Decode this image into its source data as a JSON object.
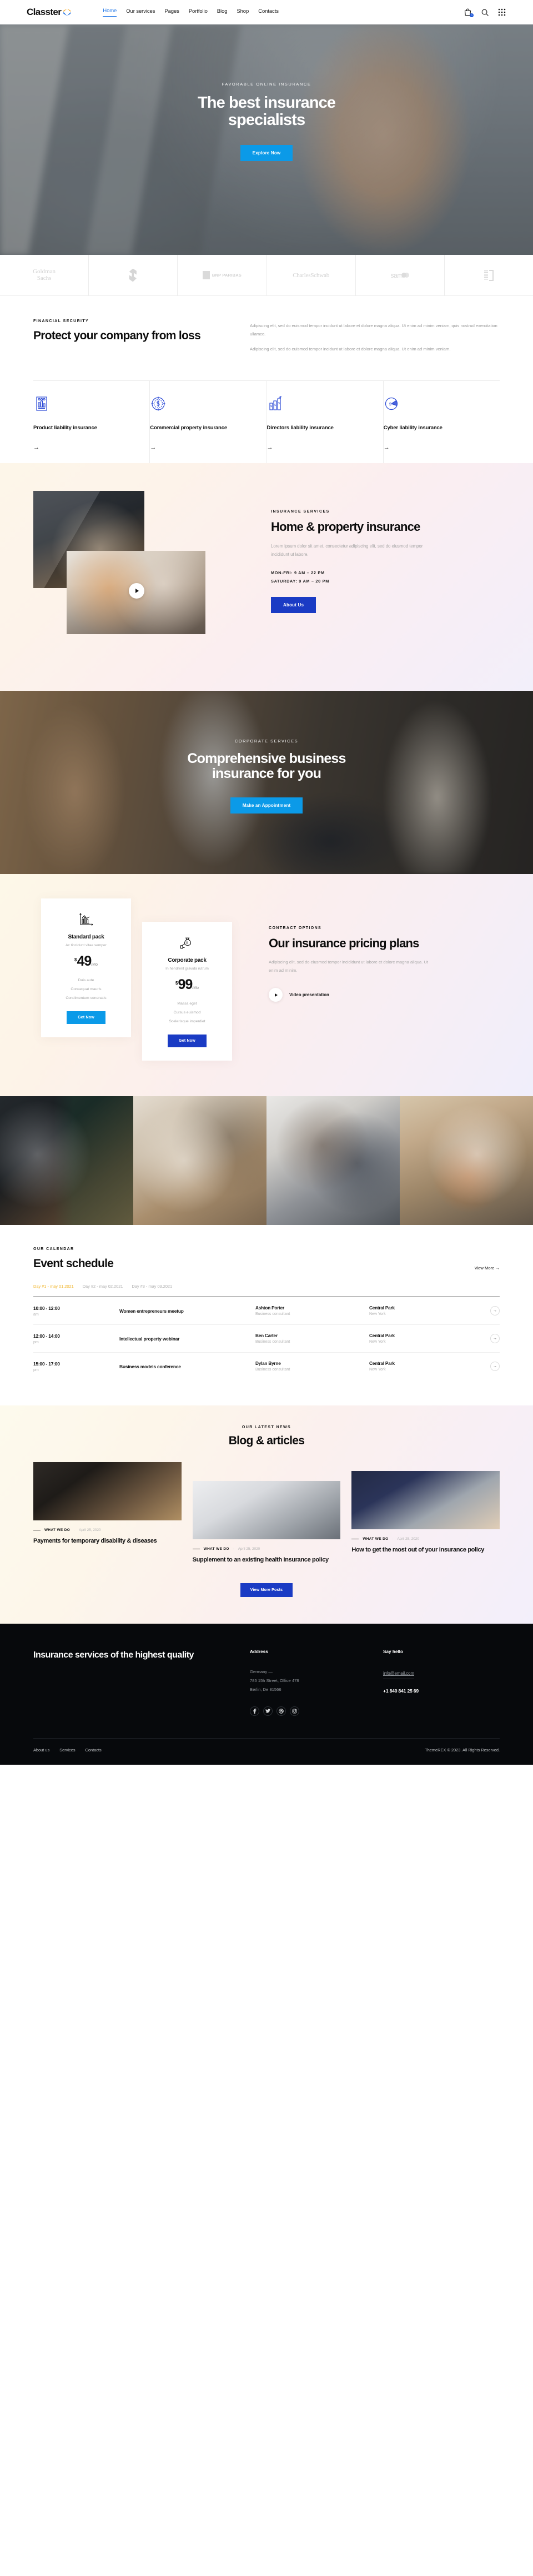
{
  "brand": {
    "name": "Classter",
    "logo_icon": "chevron-double-logo"
  },
  "nav": {
    "items": [
      {
        "label": "Home",
        "active": true
      },
      {
        "label": "Our services",
        "active": false
      },
      {
        "label": "Pages",
        "active": false
      },
      {
        "label": "Portfolio",
        "active": false
      },
      {
        "label": "Blog",
        "active": false
      },
      {
        "label": "Shop",
        "active": false
      },
      {
        "label": "Contacts",
        "active": false
      }
    ],
    "icons": {
      "cart": "shopping-bag-icon",
      "cart_count": "0",
      "search": "search-icon",
      "menu": "grid-menu-icon"
    }
  },
  "hero": {
    "eyebrow": "FAVORABLE ONLINE INSURANCE",
    "title_line1": "The best insurance",
    "title_line2": "specialists",
    "cta": "Explore Now",
    "cta_color": "#0b9ae8"
  },
  "partners": [
    {
      "name": "Goldman Sachs",
      "line1": "Goldman",
      "line2": "Sachs",
      "type": "text"
    },
    {
      "name": "swirl-logo",
      "type": "swirl"
    },
    {
      "name": "BNP PARIBAS",
      "label": "BNP PARIBAS",
      "type": "bnp"
    },
    {
      "name": "Charles Schwab",
      "label": "CharlesSchwab",
      "type": "serif"
    },
    {
      "name": "sam",
      "label": "sam",
      "type": "sam"
    },
    {
      "name": "bracket-logo",
      "type": "bracket"
    }
  ],
  "protect": {
    "eyebrow": "FINANCIAL SECURITY",
    "title": "Protect your company from loss",
    "paragraph1": "Adipiscing elit, sed do euismod tempor incidunt ut labore et dolore magna aliqua. Ut enim ad minim veniam, quis nostrud exercitation ullamco.",
    "paragraph2": "Adipiscing elit, sed do euismod tempor incidunt ut labore et dolore magna aliqua. Ut enim ad minim veniam."
  },
  "services": [
    {
      "title": "Product liability insurance",
      "icon": "bar-chart-document-icon",
      "arrow": "→"
    },
    {
      "title": "Commercial property insurance",
      "icon": "dollar-target-icon",
      "arrow": "→"
    },
    {
      "title": "Directors liability insurance",
      "icon": "money-bars-growth-icon",
      "arrow": "→"
    },
    {
      "title": "Cyber liability insurance",
      "icon": "dollar-pie-chart-icon",
      "arrow": "→"
    }
  ],
  "home_property": {
    "eyebrow": "INSURANCE SERVICES",
    "title": "Home & property insurance",
    "description": "Lorem ipsum dolor sit amet, consectetur adipiscing elit, sed do eiusmod tempor incididunt ut labore.",
    "hours_weekday": "MON-FRI: 9 AM – 22 PM",
    "hours_saturday": "SATURDAY: 9 AM – 20 PM",
    "cta": "About Us",
    "play_icon": "play-icon"
  },
  "corporate": {
    "eyebrow": "CORPORATE SERVICES",
    "title_line1": "Comprehensive business",
    "title_line2": "insurance for you",
    "cta": "Make an Appointment"
  },
  "pricing": {
    "eyebrow": "CONTRACT OPTIONS",
    "title": "Our insurance pricing plans",
    "description": "Adipiscing elit, sed do eiusmod tempor incididunt ut labore et dolore magna aliqua. Ut enim ad minim.",
    "video_label": "Video presentation",
    "plans": [
      {
        "name": "Standard pack",
        "subtitle": "Ac tincidunt vitae semper",
        "currency": "$",
        "price": "49",
        "period": "/Mo",
        "icon": "line-chart-icon",
        "features": [
          "Duis aute",
          "Consequat mauris",
          "Condimentum venenatis"
        ],
        "cta": "Get Now",
        "cta_color": "#0b9ae8"
      },
      {
        "name": "Corporate pack",
        "subtitle": "In hendrerit gravida rutrum",
        "currency": "$",
        "price": "99",
        "period": "/Mo",
        "icon": "money-bag-hand-icon",
        "features": [
          "Massa eget",
          "Cursus euismod",
          "Scelerisque imperdiet"
        ],
        "cta": "Get Now",
        "cta_color": "#1a3bc4"
      }
    ]
  },
  "gallery": [
    {
      "name": "developer-at-desk-photo"
    },
    {
      "name": "colleagues-with-tablet-photo"
    },
    {
      "name": "team-high-five-photo"
    },
    {
      "name": "businesswoman-with-laptop-photo"
    }
  ],
  "events": {
    "eyebrow": "OUR CALENDAR",
    "title": "Event schedule",
    "view_more": "View More →",
    "tabs": [
      {
        "label": "Day #1 - may 01.2021",
        "active": true
      },
      {
        "label": "Day #2 - may 02.2021",
        "active": false
      },
      {
        "label": "Day #3 - may 03.2021",
        "active": false
      }
    ],
    "rows": [
      {
        "time": "10:00 - 12:00",
        "meridiem": "am",
        "name": "Women entrepreneurs meetup",
        "person": "Ashton Porter",
        "role": "Business consultant",
        "place": "Central Park",
        "city": "New York",
        "arrow": "→"
      },
      {
        "time": "12:00 - 14:00",
        "meridiem": "pm",
        "name": "Intellectual property webinar",
        "person": "Ben Carter",
        "role": "Business consultant",
        "place": "Central Park",
        "city": "New York",
        "arrow": "→"
      },
      {
        "time": "15:00 - 17:00",
        "meridiem": "pm",
        "name": "Business models conference",
        "person": "Dylan Byrne",
        "role": "Business consultant",
        "place": "Central Park",
        "city": "New York",
        "arrow": "→"
      }
    ]
  },
  "blog": {
    "eyebrow": "OUR LATEST NEWS",
    "title": "Blog & articles",
    "cta": "View More Posts",
    "posts": [
      {
        "category": "WHAT WE DO",
        "separator": "·",
        "date": "April 25, 2020",
        "title": "Payments for temporary disability & diseases",
        "thumb": "man-in-office-photo"
      },
      {
        "category": "WHAT WE DO",
        "separator": "·",
        "date": "April 25, 2020",
        "title": "Supplement to an existing health insurance policy",
        "thumb": "woman-seated-photo"
      },
      {
        "category": "WHAT WE DO",
        "separator": "·",
        "date": "April 25, 2020",
        "title": "How to get the most out of your insurance policy",
        "thumb": "business-meeting-photo"
      }
    ]
  },
  "footer": {
    "title": "Insurance services of the highest quality",
    "address_heading": "Address",
    "address_line1": "Germany —",
    "address_line2": "785 15h Street, Office 478",
    "address_line3": "Berlin, De 81566",
    "contact_heading": "Say hello",
    "email": "info@email.com",
    "phone": "+1 840 841 25 69",
    "socials": [
      {
        "name": "facebook-icon",
        "glyph": "f"
      },
      {
        "name": "twitter-icon",
        "glyph": "t"
      },
      {
        "name": "dribbble-icon",
        "glyph": "d"
      },
      {
        "name": "instagram-icon",
        "glyph": "i"
      }
    ],
    "links": [
      {
        "label": "About us"
      },
      {
        "label": "Services"
      },
      {
        "label": "Contacts"
      }
    ],
    "copyright": "ThemeREX © 2023. All Rights Reserved."
  }
}
